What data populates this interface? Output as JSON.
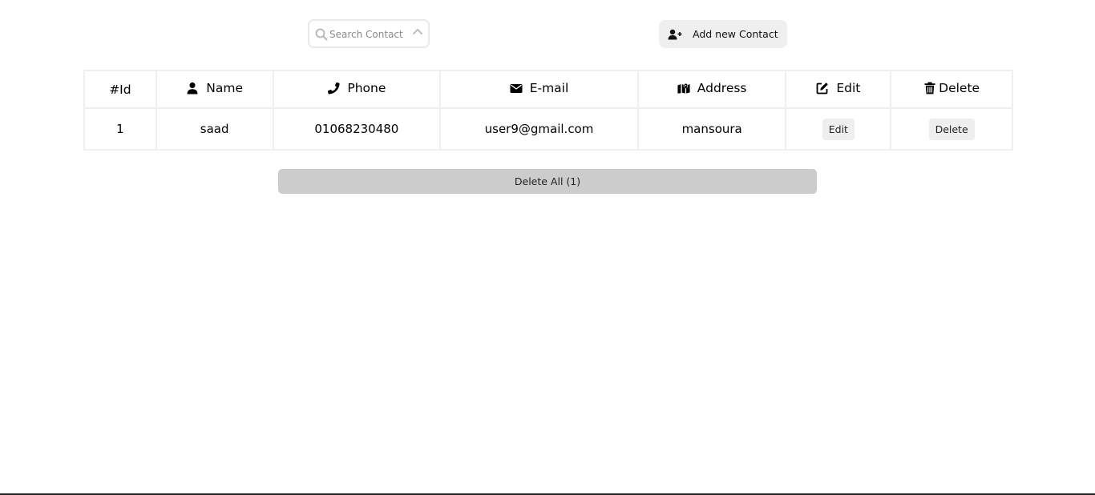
{
  "toolbar": {
    "search_placeholder": "Search Contact",
    "search_value": "",
    "add_contact_label": "Add new Contact",
    "icons": {
      "search": "search-icon",
      "sort": "chevron-up-icon",
      "add": "user-plus-icon"
    }
  },
  "table": {
    "headers": {
      "id": "#Id",
      "name": "Name",
      "phone": "Phone",
      "email": "E-mail",
      "address": "Address",
      "edit": "Edit",
      "delete": "Delete"
    },
    "header_icons": {
      "name": "user-icon",
      "phone": "phone-icon",
      "email": "envelope-icon",
      "address": "map-icon",
      "edit": "edit-icon",
      "delete": "trash-icon"
    },
    "rows": [
      {
        "id": "1",
        "name": "saad",
        "phone": "01068230480",
        "email": "user9@gmail.com",
        "address": "mansoura",
        "edit_label": "Edit",
        "delete_label": "Delete"
      }
    ]
  },
  "footer": {
    "delete_all_label": "Delete All (1)"
  },
  "colors": {
    "button_bg": "#efefef",
    "delete_all_bg": "#cccccc",
    "table_border": "#efefef"
  }
}
